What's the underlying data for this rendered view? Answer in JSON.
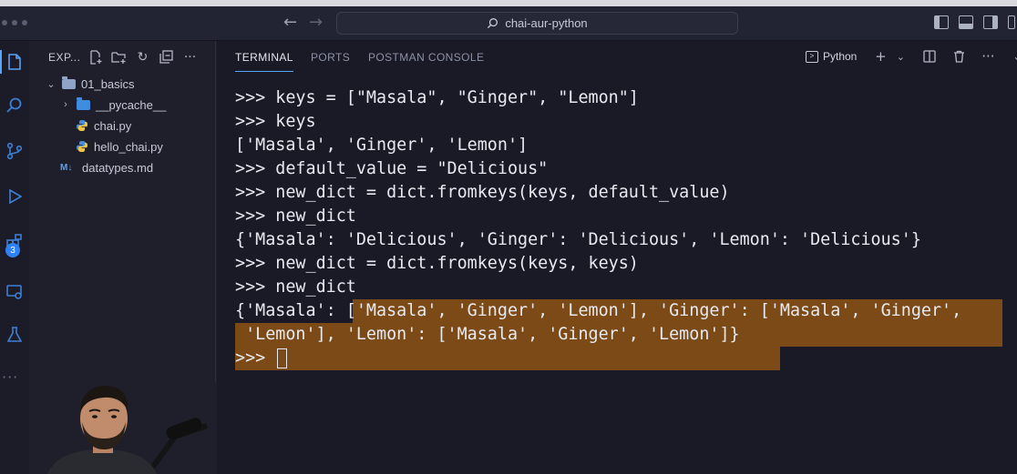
{
  "window": {
    "search_label": "chai-aur-python"
  },
  "explorer": {
    "header": "EXP...",
    "tree": [
      {
        "label": "01_basics",
        "type": "folder",
        "expanded": true
      },
      {
        "label": "__pycache__",
        "type": "folder",
        "expanded": false
      },
      {
        "label": "chai.py",
        "type": "python-file"
      },
      {
        "label": "hello_chai.py",
        "type": "python-file"
      },
      {
        "label": "datatypes.md",
        "type": "markdown-file",
        "icon_text": "M↓"
      }
    ]
  },
  "activity": {
    "source_control_badge": "3"
  },
  "panel": {
    "tabs": [
      {
        "label": "TERMINAL",
        "active": true
      },
      {
        "label": "PORTS",
        "active": false
      },
      {
        "label": "POSTMAN CONSOLE",
        "active": false
      }
    ],
    "terminal_name": "Python"
  },
  "terminal": {
    "lines": [
      ">>> keys = [\"Masala\", \"Ginger\", \"Lemon\"]",
      ">>> keys",
      "['Masala', 'Ginger', 'Lemon']",
      ">>> default_value = \"Delicious\"",
      ">>> new_dict = dict.fromkeys(keys, default_value)",
      ">>> new_dict",
      "{'Masala': 'Delicious', 'Ginger': 'Delicious', 'Lemon': 'Delicious'}",
      ">>> new_dict = dict.fromkeys(keys, keys)",
      ">>> new_dict",
      "{'Masala': ['Masala', 'Ginger', 'Lemon'], 'Ginger': ['Masala', 'Ginger',",
      " 'Lemon'], 'Lemon': ['Masala', 'Ginger', 'Lemon']}",
      ">>> "
    ]
  },
  "colors": {
    "accent": "#58a6ff",
    "selection": "#7b4a17",
    "badge": "#2f81f7"
  }
}
